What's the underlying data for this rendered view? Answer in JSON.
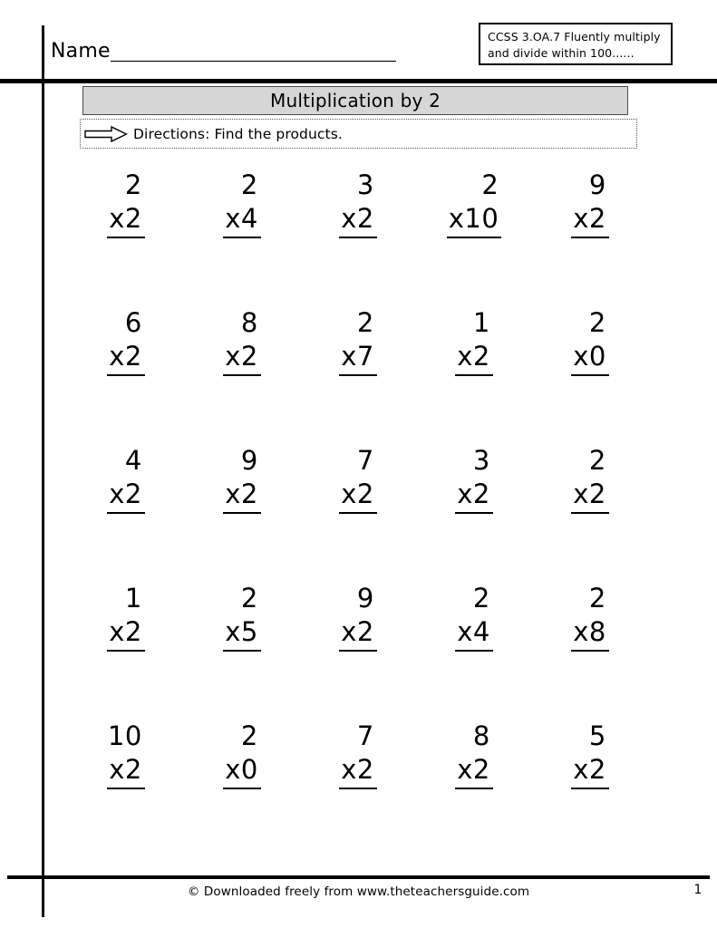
{
  "header": {
    "name_label": "Name",
    "name_blank": "______________________________",
    "ccss_line1": "CCSS 3.OA.7 Fluently multiply",
    "ccss_line2": "and divide   within 100......"
  },
  "title": {
    "text": "Multiplication by 2"
  },
  "directions": {
    "icon": "right-arrow-icon",
    "text": "Directions: Find the products."
  },
  "operator": "x",
  "problems": {
    "rows": [
      [
        {
          "top": "2",
          "bottom": "x2"
        },
        {
          "top": "2",
          "bottom": "x4"
        },
        {
          "top": "3",
          "bottom": "x2"
        },
        {
          "top": "2",
          "bottom": "x10"
        },
        {
          "top": "9",
          "bottom": "x2"
        }
      ],
      [
        {
          "top": "6",
          "bottom": "x2"
        },
        {
          "top": "8",
          "bottom": "x2"
        },
        {
          "top": "2",
          "bottom": "x7"
        },
        {
          "top": "1",
          "bottom": "x2"
        },
        {
          "top": "2",
          "bottom": "x0"
        }
      ],
      [
        {
          "top": "4",
          "bottom": "x2"
        },
        {
          "top": "9",
          "bottom": "x2"
        },
        {
          "top": "7",
          "bottom": "x2"
        },
        {
          "top": "3",
          "bottom": "x2"
        },
        {
          "top": "2",
          "bottom": "x2"
        }
      ],
      [
        {
          "top": "1",
          "bottom": "x2"
        },
        {
          "top": "2",
          "bottom": "x5"
        },
        {
          "top": "9",
          "bottom": "x2"
        },
        {
          "top": "2",
          "bottom": "x4"
        },
        {
          "top": "2",
          "bottom": "x8"
        }
      ],
      [
        {
          "top": "10",
          "bottom": "x2"
        },
        {
          "top": "2",
          "bottom": "x0"
        },
        {
          "top": "7",
          "bottom": "x2"
        },
        {
          "top": "8",
          "bottom": "x2"
        },
        {
          "top": "5",
          "bottom": "x2"
        }
      ]
    ]
  },
  "footer": {
    "credit": "© Downloaded freely from www.theteachersguide.com",
    "page_number": "1"
  },
  "colors": {
    "title_bar_fill": "#d6d6d6",
    "rule": "#000000",
    "text": "#000000"
  }
}
